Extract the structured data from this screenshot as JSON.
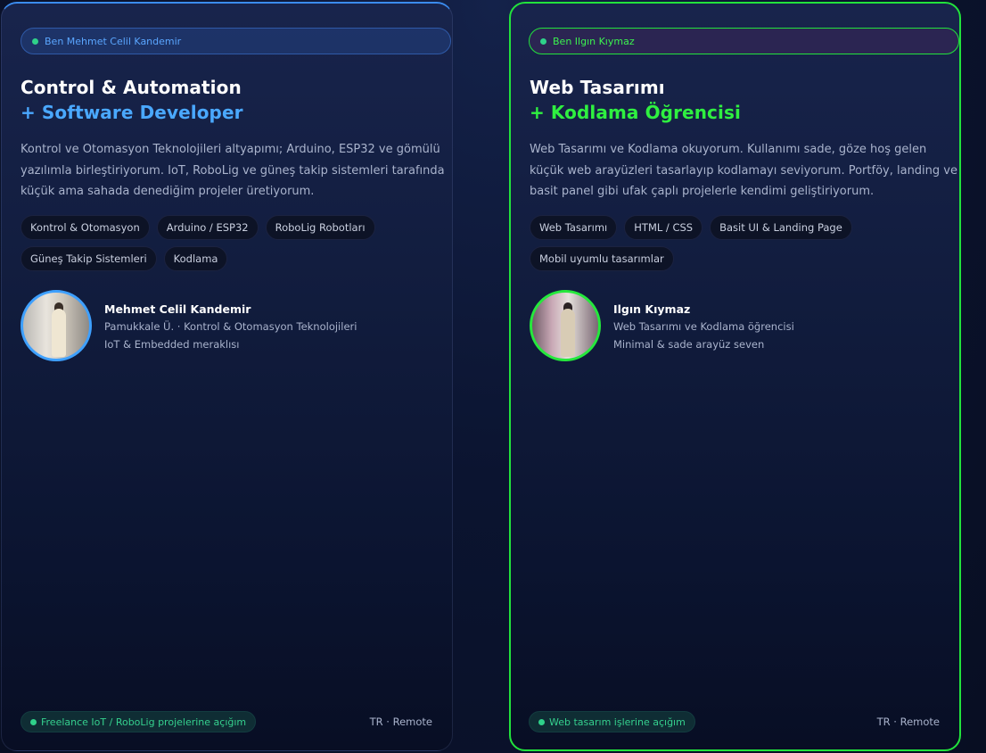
{
  "cards": [
    {
      "badge": "Ben Mehmet Celil Kandemir",
      "title": "Control & Automation",
      "subtitle": "+ Software Developer",
      "description": "Kontrol ve Otomasyon Teknolojileri altyapımı; Arduino, ESP32 ve gömülü yazılımla birleştiriyorum. IoT, RoboLig ve güneş takip sistemleri tarafında küçük ama sahada denediğim projeler üretiyorum.",
      "tags": [
        "Kontrol & Otomasyon",
        "Arduino / ESP32",
        "RoboLig Robotları",
        "Güneş Takip Sistemleri",
        "Kodlama"
      ],
      "profile": {
        "name": "Mehmet Celil Kandemir",
        "line1": "Pamukkale Ü. · Kontrol & Otomasyon Teknolojileri",
        "line2": "IoT & Embedded meraklısı"
      },
      "status": "Freelance IoT / RoboLig projelerine açığım",
      "location": "TR · Remote",
      "accent": "#3b8cf0"
    },
    {
      "badge": "Ben Ilgın Kıymaz",
      "title": "Web Tasarımı",
      "subtitle": "+ Kodlama Öğrencisi",
      "description": "Web Tasarımı ve Kodlama okuyorum. Kullanımı sade, göze hoş gelen küçük web arayüzleri tasarlayıp kodlamayı seviyorum. Portföy, landing ve basit panel gibi ufak çaplı projelerle kendimi geliştiriyorum.",
      "tags": [
        "Web Tasarımı",
        "HTML / CSS",
        "Basit UI & Landing Page",
        "Mobil uyumlu tasarımlar"
      ],
      "profile": {
        "name": "Ilgın Kıymaz",
        "line1": "Web Tasarımı ve Kodlama öğrencisi",
        "line2": "Minimal & sade arayüz seven"
      },
      "status": "Web tasarım işlerine açığım",
      "location": "TR · Remote",
      "accent": "#22e33c"
    }
  ]
}
